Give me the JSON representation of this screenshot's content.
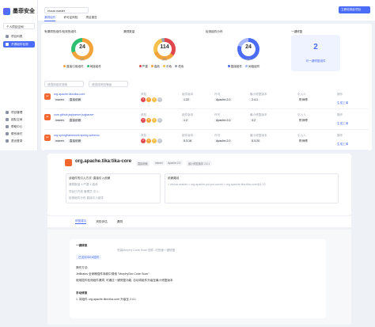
{
  "app": {
    "name": "墨菲安全",
    "project": "个人项目空间"
  },
  "nav": [
    {
      "label": "项目列表",
      "active": false
    },
    {
      "label": "开源组件检测",
      "active": true
    }
  ],
  "bottom_nav": [
    "项目管理",
    "团队空间",
    "帮助中心",
    "联系我们",
    "退出登录"
  ],
  "header": {
    "branch": "elocar-master",
    "button": "立即检测此项目",
    "tabs": [
      "漏洞组件",
      "许可证风险",
      "项目报告"
    ]
  },
  "cards": [
    {
      "title": "有漏洞的组件/检测的组件",
      "value": "24",
      "sub": "组件",
      "legend": [
        "直接引用组件",
        "间接组件"
      ],
      "colors": [
        "#f2a33a",
        "#2fbf71"
      ]
    },
    {
      "title": "漏洞数量",
      "value": "114",
      "sub": "漏洞",
      "legend": [
        "严重",
        "高危",
        "中危",
        "低危"
      ],
      "colors": [
        "#e0474c",
        "#f2a33a",
        "#f5c04a",
        "#9aa0aa"
      ]
    },
    {
      "title": "检测组件分布",
      "value": "24",
      "sub": "组件",
      "legend": [
        "直接组件",
        "间接组件"
      ],
      "colors": [
        "#4a6cf7",
        "#a6b6ff"
      ]
    }
  ],
  "oneclick": {
    "title": "一键修复",
    "value": "2",
    "label": "可一键修复组件"
  },
  "filters": [
    "请选择组件搜索",
    "请选择风险等级"
  ],
  "columns": [
    "风险",
    "组件版本",
    "许可",
    "最小修复版本",
    "引入人",
    "操作"
  ],
  "rows": [
    {
      "name": "org.apache.tika:tika-core",
      "tags": [
        "maven",
        "直接依赖"
      ],
      "severity": [
        "4",
        "4",
        "2",
        "0"
      ],
      "version": "1.22",
      "license": "Apache-2.0",
      "fix": "2.4.1",
      "owner": "陈师傅",
      "a1": "查看",
      "a2": "生成工单"
    },
    {
      "name": "com.github.jsqlparser:jsqlparser",
      "tags": [
        "maven",
        "直接依赖"
      ],
      "severity": [
        "2",
        "3",
        "1",
        "0"
      ],
      "version": "1.2",
      "license": "Apache-2.0",
      "fix": "4.2",
      "owner": "陈师傅",
      "a1": "查看",
      "a2": "生成工单"
    },
    {
      "name": "org.springframework:spring-webmvc",
      "tags": [
        "maven",
        "直接依赖"
      ],
      "severity": [
        "2",
        "2",
        "2",
        "1"
      ],
      "version": "5.3.18",
      "license": "Apache-2.0",
      "fix": "5.3.20",
      "owner": "陈师傅",
      "a1": "查看",
      "a2": "生成工单"
    }
  ],
  "detail": {
    "title": "org.apache.tika:tika-core",
    "chips": [
      "直接依赖",
      "maven",
      "Apache-2.0",
      "最小修复版本 2.4.1"
    ],
    "box1": [
      "该组件的引入方式: 直接引入依赖",
      "漏洞数量 4 严重 4 高危",
      "项目已开放 管理员 引入",
      "检测组件分布 直接引入组件"
    ],
    "box2_title": "依赖路径",
    "box2_line": "> elocar-master > org.apache.poi:poi-ooxml > org.apache.tika:tika-core@1.22"
  },
  "detail_tabs": [
    "修复建议",
    "风险评估",
    "漏洞"
  ],
  "fix": {
    "t1": "一键修复",
    "t2": "安装Murphy Code Scan 插件, 可快速一键修复",
    "badge": "已支持IDEA插件",
    "t3": "操作方法:",
    "t4": "JetBrains 全家桶插件商城中搜索 \"MurphySec Code Scan\"",
    "t5": "使用插件检测组件漏洞, 可通过一键修复功能, 自动将组件升级至最小修复版本",
    "t6": "手动修复",
    "t7": "1. 将组件 org.apache.tika:tika-core 升级至 2.4.1"
  }
}
